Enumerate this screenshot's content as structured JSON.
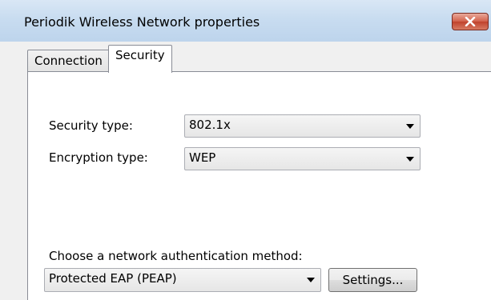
{
  "window": {
    "title": "Periodik Wireless Network properties"
  },
  "tabs": [
    {
      "label": "Connection"
    },
    {
      "label": "Security"
    }
  ],
  "security": {
    "security_type_label": "Security type:",
    "security_type_value": "802.1x",
    "encryption_type_label": "Encryption type:",
    "encryption_type_value": "WEP",
    "auth_method_label": "Choose a network authentication method:",
    "auth_method_value": "Protected EAP (PEAP)",
    "settings_label": "Settings..."
  },
  "icons": {
    "close": "close-x-icon",
    "dropdown": "chevron-down-icon"
  },
  "colors": {
    "titlebar": "#c8dcf0",
    "close_button": "#c0422c",
    "panel_background": "#ffffff",
    "dialog_background": "#f0f0f0"
  }
}
